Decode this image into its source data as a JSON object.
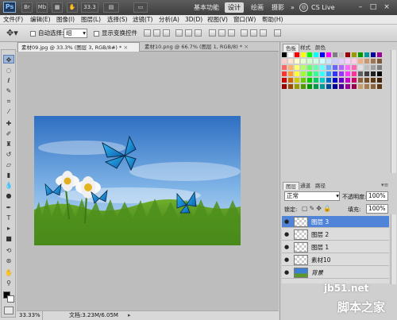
{
  "app": {
    "logo_text": "Ps",
    "zoom_value": "33.3",
    "workspace_buttons": [
      "基本功能",
      "设计",
      "绘画",
      "摄影"
    ],
    "active_workspace": "设计",
    "more_arrows": "»",
    "cslive_label": "CS Live",
    "window_controls": [
      "–",
      "□",
      "×"
    ]
  },
  "menubar": {
    "items": [
      "文件(F)",
      "编辑(E)",
      "图像(I)",
      "图层(L)",
      "选择(S)",
      "滤镜(T)",
      "分析(A)",
      "3D(D)",
      "视图(V)",
      "窗口(W)",
      "帮助(H)"
    ]
  },
  "options": {
    "auto_select_label": "自动选择:",
    "auto_select_value": "组",
    "show_transform_label": "显示变换控件"
  },
  "tabs": [
    {
      "label": "素材09.jpg @ 33.3% (图层 3, RGB/8#) *",
      "close": "×"
    },
    {
      "label": "素材10.png @ 66.7% (图层 1, RGB/8) *",
      "close": "×"
    }
  ],
  "statusbar": {
    "zoom": "33.33%",
    "doc_info": "文档:3.23M/6.05M"
  },
  "swatches_panel": {
    "tabs": [
      "色板",
      "样式",
      "颜色"
    ],
    "colors": [
      "#000000",
      "#ffffff",
      "#ff0000",
      "#ffff00",
      "#00ff00",
      "#00ffff",
      "#0000ff",
      "#ff00ff",
      "#7f7f7f",
      "#c0c0c0",
      "#9a0000",
      "#9a9a00",
      "#009a00",
      "#009a9a",
      "#00009a",
      "#9a009a",
      "#ffcccc",
      "#ffe5cc",
      "#ffffcc",
      "#e5ffcc",
      "#ccffcc",
      "#ccffe5",
      "#ccffff",
      "#cce5ff",
      "#ccccff",
      "#e5ccff",
      "#ffccff",
      "#ffcce5",
      "#f0b080",
      "#c89870",
      "#a07850",
      "#805838",
      "#ff6666",
      "#ffb266",
      "#ffff66",
      "#b2ff66",
      "#66ff66",
      "#66ffb2",
      "#66ffff",
      "#66b2ff",
      "#6666ff",
      "#b266ff",
      "#ff66ff",
      "#ff66b2",
      "#e0e0e0",
      "#bfbfbf",
      "#9f9f9f",
      "#7f7f7f",
      "#ff3333",
      "#ff9933",
      "#ffff33",
      "#99ff33",
      "#33ff33",
      "#33ff99",
      "#33ffff",
      "#3399ff",
      "#3333ff",
      "#9933ff",
      "#ff33ff",
      "#ff3399",
      "#5f5f5f",
      "#3f3f3f",
      "#1f1f1f",
      "#000000",
      "#cc0000",
      "#cc6600",
      "#cccc00",
      "#66cc00",
      "#00cc00",
      "#00cc66",
      "#00cccc",
      "#0066cc",
      "#0000cc",
      "#6600cc",
      "#cc00cc",
      "#cc0066",
      "#8c6239",
      "#754c24",
      "#603913",
      "#42210b",
      "#990000",
      "#994c00",
      "#999900",
      "#4c9900",
      "#009900",
      "#00994c",
      "#009999",
      "#004c99",
      "#000099",
      "#4c0099",
      "#990099",
      "#99004c",
      "#c69c6d",
      "#a67c52",
      "#8c6239",
      "#603813"
    ]
  },
  "layers_panel": {
    "tabs": [
      "图层",
      "通道",
      "路径"
    ],
    "blend_mode": "正常",
    "opacity_label": "不透明度:",
    "opacity_value": "100%",
    "lock_label": "锁定:",
    "fill_label": "填充:",
    "fill_value": "100%",
    "layers": [
      {
        "name": "图层 3",
        "selected": true
      },
      {
        "name": "图层 2",
        "selected": false
      },
      {
        "name": "图层 1",
        "selected": false
      },
      {
        "name": "素材10",
        "selected": false
      },
      {
        "name": "背景",
        "selected": false
      }
    ]
  },
  "watermark": {
    "site": "jb51.net",
    "name": "脚本之家"
  }
}
